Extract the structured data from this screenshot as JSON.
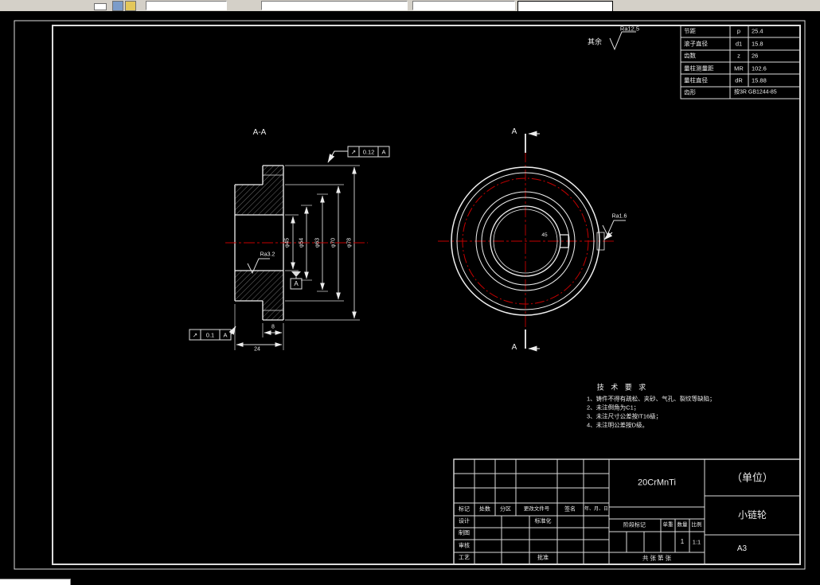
{
  "colors": {
    "background": "#000000",
    "line": "#ececec",
    "centerline": "#c40000"
  },
  "drawing": {
    "section_view_label": "A-A",
    "section_cut_label": "A",
    "default_roughness": {
      "prefix": "其余",
      "value": "Ra12.5"
    },
    "param_table": {
      "rows": [
        {
          "label": "节距",
          "sym": "p",
          "val": "25.4"
        },
        {
          "label": "滚子直径",
          "sym": "d1",
          "val": "15.8"
        },
        {
          "label": "齿数",
          "sym": "z",
          "val": "26"
        },
        {
          "label": "量柱测量距",
          "sym": "MR",
          "val": "102.6"
        },
        {
          "label": "量柱直径",
          "sym": "dR",
          "val": "15.88"
        },
        {
          "label": "齿形",
          "sym": "",
          "val": "按3R GB1244-85"
        }
      ]
    },
    "dims": {
      "bore": "φ45",
      "step": "φ54",
      "hub": "φ63",
      "root": "φ70",
      "tip": "φ78",
      "width": "24",
      "tooth_width": "8",
      "bore_note": "45"
    },
    "tolerance_top": {
      "sym": "↗",
      "val": "0.12",
      "datum": "A"
    },
    "tolerance_bottom": {
      "sym": "↗",
      "val": "0.1",
      "datum": "A"
    },
    "datum_label": "A",
    "roughness_bore": "Ra3.2",
    "roughness_keyway": "Ra1.6",
    "tech_req": {
      "title": "技 术 要 求",
      "items": [
        "1、铸件不得有疏松、夹砂、气孔、裂纹等缺陷；",
        "2、未注倒角为C1；",
        "3、未注尺寸公差按IT16级；",
        "4、未注明公差按D级。"
      ]
    }
  },
  "title_block": {
    "material": "20CrMnTi",
    "unit": "（单位）",
    "part_name": "小链轮",
    "sheet_size": "A3",
    "qty": "1",
    "scale": "1:1",
    "sheets": "共  张  第  张",
    "labels": {
      "mark": "标记",
      "count": "处数",
      "zone": "分区",
      "doc_no": "更改文件号",
      "sign": "签名",
      "date": "年、月、日",
      "design": "设计",
      "standardize": "标准化",
      "draft": "制图",
      "check": "审核",
      "process": "工艺",
      "approve": "批准",
      "stage": "阶段标记",
      "weight": "单重",
      "quantity": "数量",
      "scale_lbl": "比例"
    }
  }
}
